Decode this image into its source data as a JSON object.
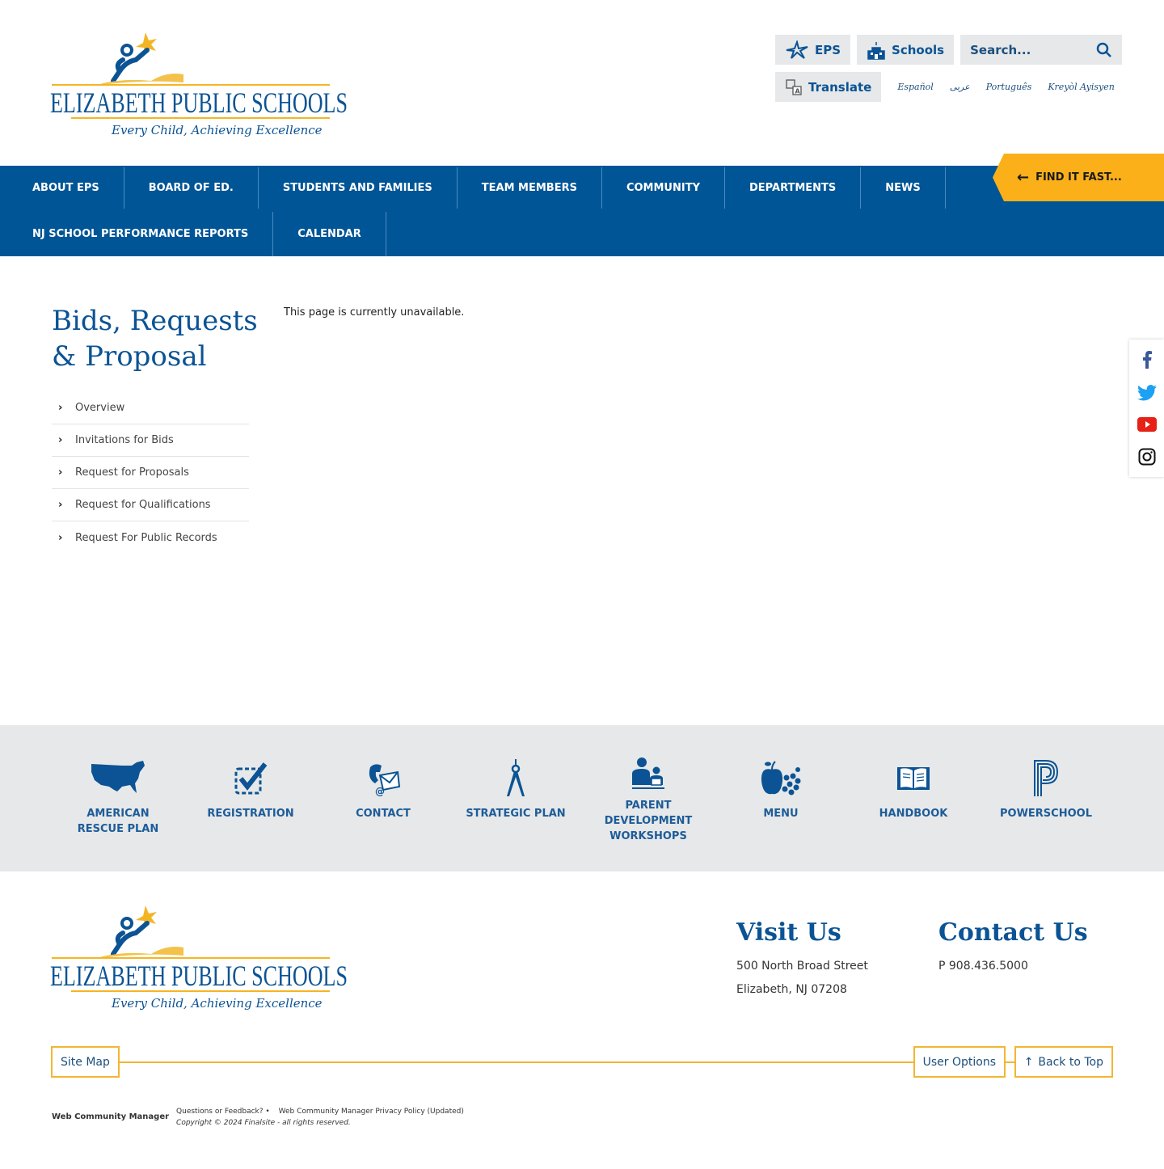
{
  "brand": {
    "name": "ELIZABETH PUBLIC SCHOOLS",
    "tagline": "Every Child, Achieving Excellence",
    "primary_color": "#005596",
    "accent_color": "#fbb01a"
  },
  "utility": {
    "eps_label": "EPS",
    "schools_label": "Schools",
    "search_placeholder": "Search...",
    "translate_label": "Translate",
    "languages": [
      "Español",
      "عربى",
      "Português",
      "Kreyòl Ayisyen"
    ]
  },
  "nav": {
    "row1": [
      "ABOUT EPS",
      "BOARD OF ED.",
      "STUDENTS AND FAMILIES",
      "TEAM MEMBERS",
      "COMMUNITY",
      "DEPARTMENTS",
      "NEWS"
    ],
    "row2": [
      "NJ SCHOOL PERFORMANCE REPORTS",
      "CALENDAR"
    ],
    "find_it_fast": "FIND IT FAST..."
  },
  "main": {
    "title_line1": "Bids, Requests",
    "title_line2": "& Proposal",
    "message": "This page is currently unavailable.",
    "subnav": [
      "Overview",
      "Invitations for Bids",
      "Request for Proposals",
      "Request for Qualifications",
      "Request For Public Records"
    ]
  },
  "social": [
    "facebook-icon",
    "twitter-icon",
    "youtube-icon",
    "instagram-icon"
  ],
  "quicklinks": [
    {
      "line1": "AMERICAN",
      "line2": "RESCUE PLAN",
      "line3": "",
      "icon": "usa-map-icon"
    },
    {
      "line1": "REGISTRATION",
      "line2": "",
      "line3": "",
      "icon": "checkbox-icon"
    },
    {
      "line1": "CONTACT",
      "line2": "",
      "line3": "",
      "icon": "phone-mail-icon"
    },
    {
      "line1": "STRATEGIC PLAN",
      "line2": "",
      "line3": "",
      "icon": "compass-icon"
    },
    {
      "line1": "PARENT",
      "line2": "DEVELOPMENT",
      "line3": "WORKSHOPS",
      "icon": "parent-child-icon"
    },
    {
      "line1": "MENU",
      "line2": "",
      "line3": "",
      "icon": "fruit-icon"
    },
    {
      "line1": "HANDBOOK",
      "line2": "",
      "line3": "",
      "icon": "book-icon"
    },
    {
      "line1": "POWERSCHOOL",
      "line2": "",
      "line3": "",
      "icon": "powerschool-icon"
    }
  ],
  "footer": {
    "visit_heading": "Visit Us",
    "address1": "500 North Broad Street",
    "address2": "Elizabeth, NJ 07208",
    "contact_heading": "Contact Us",
    "phone": "P 908.436.5000",
    "site_map": "Site Map",
    "user_options": "User Options",
    "back_to_top": "Back to Top",
    "wcm": "Web Community Manager",
    "questions": "Questions or Feedback? •",
    "privacy": "Web Community Manager Privacy Policy (Updated)",
    "copyright": "Copyright © 2024 Finalsite - all rights reserved."
  }
}
